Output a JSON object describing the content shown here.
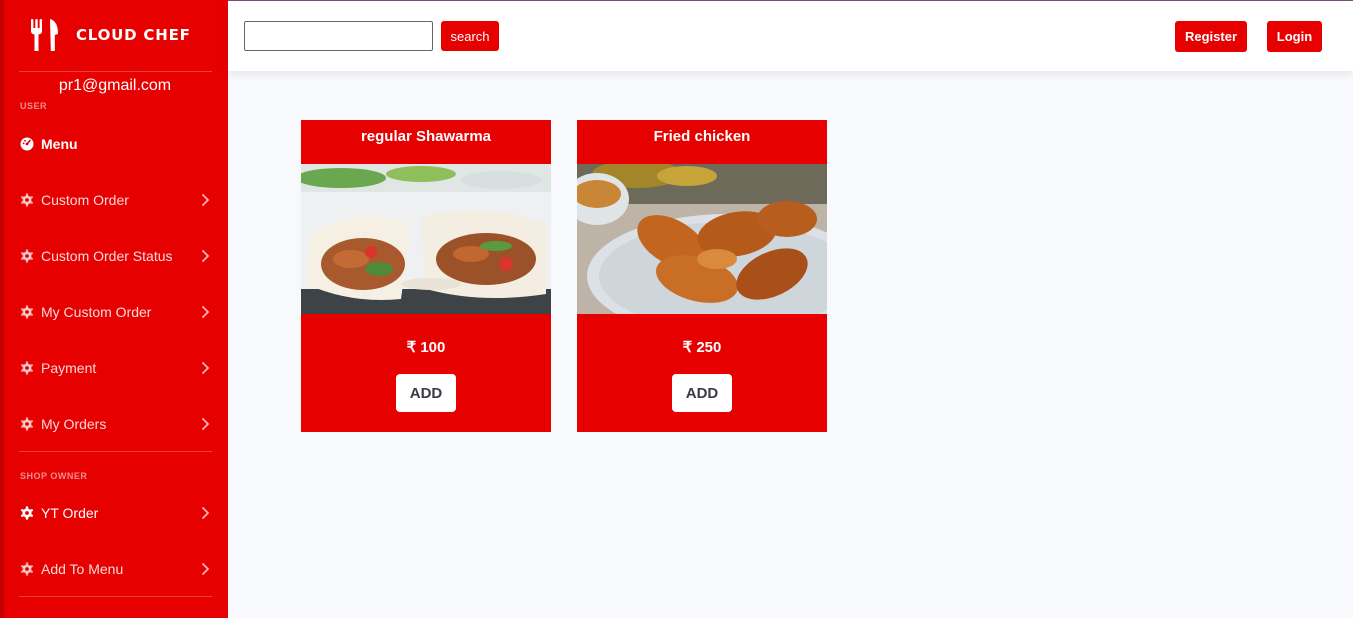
{
  "sidebar": {
    "brand": "CLOUD CHEF",
    "email": "pr1@gmail.com",
    "user_section": "USER",
    "owner_section": "SHOP OWNER",
    "items": [
      {
        "label": "Menu",
        "icon": "dashboard-icon"
      },
      {
        "label": "Custom Order",
        "icon": "gear-icon"
      },
      {
        "label": "Custom Order Status",
        "icon": "gear-icon"
      },
      {
        "label": "My Custom Order",
        "icon": "gear-icon"
      },
      {
        "label": "Payment",
        "icon": "gear-icon"
      },
      {
        "label": "My Orders",
        "icon": "gear-icon"
      }
    ],
    "owner_items": [
      {
        "label": "YT Order",
        "icon": "gear-icon"
      },
      {
        "label": "Add To Menu",
        "icon": "gear-icon"
      }
    ]
  },
  "topbar": {
    "search_value": "",
    "search_label": "search",
    "register_label": "Register",
    "login_label": "Login"
  },
  "cards": [
    {
      "title": "regular Shawarma",
      "price": "₹ 100",
      "add_label": "ADD"
    },
    {
      "title": "Fried chicken",
      "price": "₹ 250",
      "add_label": "ADD"
    }
  ],
  "colors": {
    "accent": "#e60000",
    "background": "#f8f9fc"
  }
}
